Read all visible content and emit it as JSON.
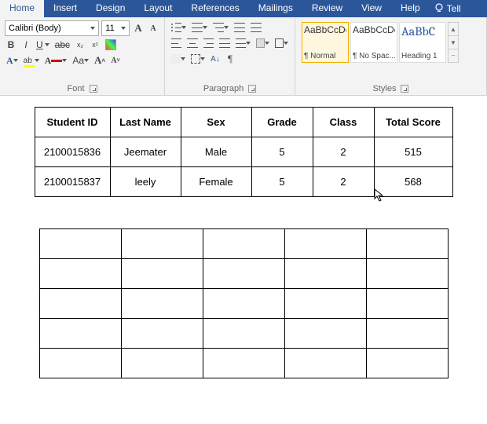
{
  "tabs": {
    "home": "Home",
    "insert": "Insert",
    "design": "Design",
    "layout": "Layout",
    "references": "References",
    "mailings": "Mailings",
    "review": "Review",
    "view": "View",
    "help": "Help",
    "tell": "Tell"
  },
  "font": {
    "name": "Calibri (Body)",
    "size": "11",
    "group": "Font",
    "bold": "B",
    "italic": "I",
    "under": "U",
    "strike": "abc",
    "sub": "x₂",
    "sup": "x²",
    "incA": "A",
    "decA": "A",
    "caseA": "Aa",
    "clearA": "A"
  },
  "para": {
    "group": "Paragraph"
  },
  "styles": {
    "group": "Styles",
    "prev": "AaBbCcDc",
    "prevBig": "AaBbC",
    "items": [
      {
        "name": "¶ Normal"
      },
      {
        "name": "¶ No Spac..."
      },
      {
        "name": "Heading 1"
      }
    ]
  },
  "table1": {
    "headers": [
      "Student ID",
      "Last Name",
      "Sex",
      "Grade",
      "Class",
      "Total Score"
    ],
    "rows": [
      [
        "2100015836",
        "Jeemater",
        "Male",
        "5",
        "2",
        "515"
      ],
      [
        "2100015837",
        "leely",
        "Female",
        "5",
        "2",
        "568"
      ]
    ]
  },
  "table2": {
    "rows": 5,
    "cols": 5
  }
}
